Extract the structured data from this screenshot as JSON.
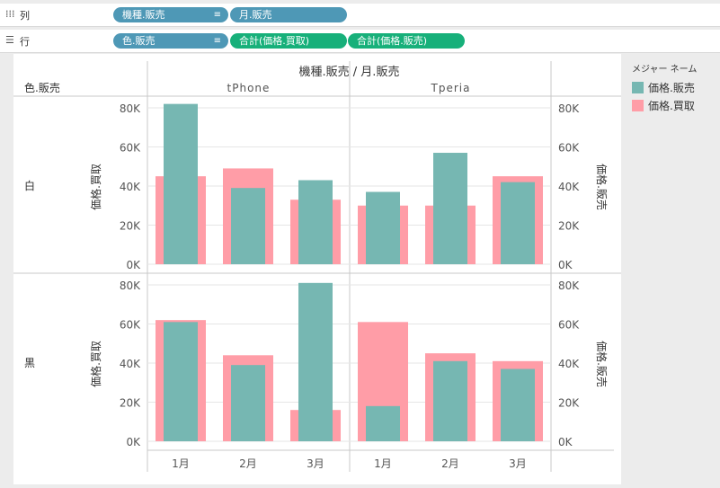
{
  "shelves": {
    "columns": {
      "label": "列",
      "pills": [
        "機種.販売",
        "月.販売"
      ]
    },
    "rows": {
      "label": "行",
      "pills": [
        "色.販売",
        "合計(価格.買取)",
        "合計(価格.販売)"
      ]
    }
  },
  "legend": {
    "title": "メジャー ネーム",
    "items": [
      {
        "label": "価格.販売",
        "color": "#76b7b2"
      },
      {
        "label": "価格.買取",
        "color": "#ff9da7"
      }
    ]
  },
  "chart_data": {
    "type": "bar",
    "header_title": "機種.販売 / 月.販売",
    "row_header_title": "色.販売",
    "models": [
      "tPhone",
      "Tperia"
    ],
    "months": [
      "1月",
      "2月",
      "3月"
    ],
    "colors": [
      "白",
      "黒"
    ],
    "left_axis_label": "価格.買取",
    "right_axis_label": "価格.販売",
    "y_ticks": [
      "0K",
      "20K",
      "40K",
      "60K",
      "80K"
    ],
    "ylim": [
      0,
      80000
    ],
    "series": [
      {
        "name": "価格.販売",
        "color": "#76b7b2",
        "values": {
          "白": {
            "tPhone": [
              82000,
              39000,
              43000
            ],
            "Tperia": [
              37000,
              57000,
              42000
            ]
          },
          "黒": {
            "tPhone": [
              61000,
              39000,
              81000
            ],
            "Tperia": [
              18000,
              41000,
              37000
            ]
          }
        }
      },
      {
        "name": "価格.買取",
        "color": "#ff9da7",
        "values": {
          "白": {
            "tPhone": [
              45000,
              49000,
              33000
            ],
            "Tperia": [
              30000,
              30000,
              45000
            ]
          },
          "黒": {
            "tPhone": [
              62000,
              44000,
              16000
            ],
            "Tperia": [
              61000,
              45000,
              41000
            ]
          }
        }
      }
    ]
  }
}
